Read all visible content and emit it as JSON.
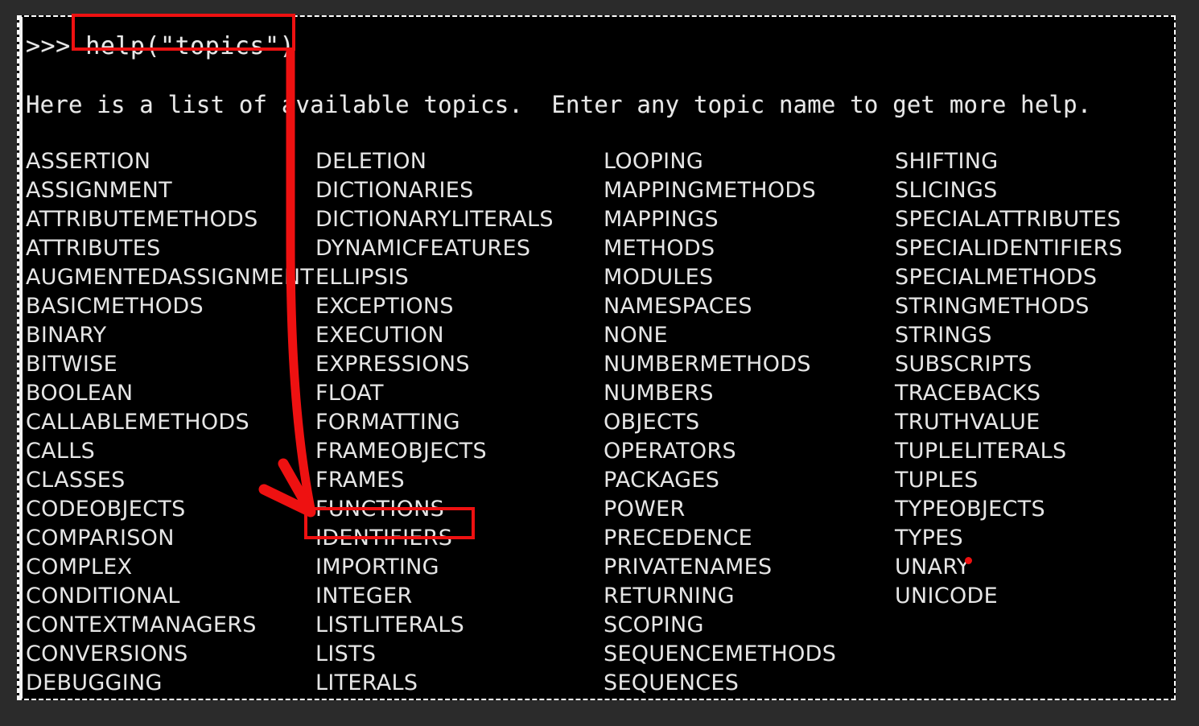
{
  "terminal": {
    "prompt_symbol": ">>> ",
    "command": "help(\"topics\")",
    "prompt_line": ">>> help(\"topics\")",
    "intro_line": "Here is a list of available topics.  Enter any topic name to get more help.",
    "background_color": "#000000",
    "text_color": "#e6e6e6",
    "frame_border_color": "#ffffff",
    "outer_background_color": "#2b2b2b"
  },
  "annotations": {
    "color": "#ee1111",
    "command_box_label": "help(\"topics\")",
    "target_box_label": "IDENTIFIERS",
    "arrow_from": "help(\"topics\")",
    "arrow_to": "IDENTIFIERS",
    "dot_near": "UNARY"
  },
  "topics": {
    "columns": [
      [
        "ASSERTION",
        "ASSIGNMENT",
        "ATTRIBUTEMETHODS",
        "ATTRIBUTES",
        "AUGMENTEDASSIGNMENT",
        "BASICMETHODS",
        "BINARY",
        "BITWISE",
        "BOOLEAN",
        "CALLABLEMETHODS",
        "CALLS",
        "CLASSES",
        "CODEOBJECTS",
        "COMPARISON",
        "COMPLEX",
        "CONDITIONAL",
        "CONTEXTMANAGERS",
        "CONVERSIONS",
        "DEBUGGING"
      ],
      [
        "DELETION",
        "DICTIONARIES",
        "DICTIONARYLITERALS",
        "DYNAMICFEATURES",
        "ELLIPSIS",
        "EXCEPTIONS",
        "EXECUTION",
        "EXPRESSIONS",
        "FLOAT",
        "FORMATTING",
        "FRAMEOBJECTS",
        "FRAMES",
        "FUNCTIONS",
        "IDENTIFIERS",
        "IMPORTING",
        "INTEGER",
        "LISTLITERALS",
        "LISTS",
        "LITERALS"
      ],
      [
        "LOOPING",
        "MAPPINGMETHODS",
        "MAPPINGS",
        "METHODS",
        "MODULES",
        "NAMESPACES",
        "NONE",
        "NUMBERMETHODS",
        "NUMBERS",
        "OBJECTS",
        "OPERATORS",
        "PACKAGES",
        "POWER",
        "PRECEDENCE",
        "PRIVATENAMES",
        "RETURNING",
        "SCOPING",
        "SEQUENCEMETHODS",
        "SEQUENCES"
      ],
      [
        "SHIFTING",
        "SLICINGS",
        "SPECIALATTRIBUTES",
        "SPECIALIDENTIFIERS",
        "SPECIALMETHODS",
        "STRINGMETHODS",
        "STRINGS",
        "SUBSCRIPTS",
        "TRACEBACKS",
        "TRUTHVALUE",
        "TUPLELITERALS",
        "TUPLES",
        "TYPEOBJECTS",
        "TYPES",
        "UNARY",
        "UNICODE"
      ]
    ]
  }
}
